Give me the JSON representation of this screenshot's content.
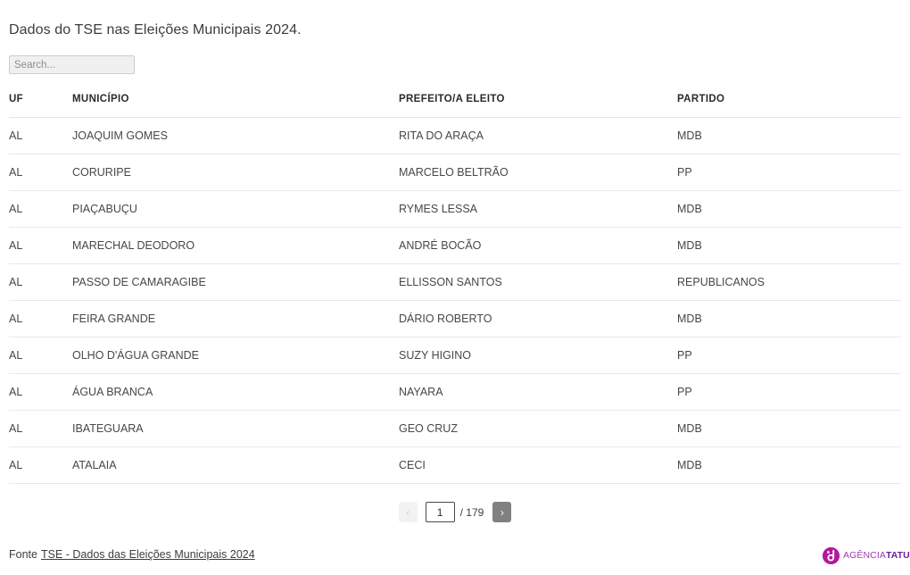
{
  "header": {
    "title": "Dados do TSE nas Eleições Municipais 2024."
  },
  "search": {
    "placeholder": "Search...",
    "value": ""
  },
  "table": {
    "columns": [
      "UF",
      "MUNICÍPIO",
      "PREFEITO/A ELEITO",
      "PARTIDO"
    ],
    "rows": [
      {
        "uf": "AL",
        "municipio": "JOAQUIM GOMES",
        "prefeito": "RITA DO ARAÇA",
        "partido": "MDB"
      },
      {
        "uf": "AL",
        "municipio": "CORURIPE",
        "prefeito": "MARCELO BELTRÃO",
        "partido": "PP"
      },
      {
        "uf": "AL",
        "municipio": "PIAÇABUÇU",
        "prefeito": "RYMES LESSA",
        "partido": "MDB"
      },
      {
        "uf": "AL",
        "municipio": "MARECHAL DEODORO",
        "prefeito": "ANDRÉ BOCÃO",
        "partido": "MDB"
      },
      {
        "uf": "AL",
        "municipio": "PASSO DE CAMARAGIBE",
        "prefeito": "ELLISSON SANTOS",
        "partido": "REPUBLICANOS"
      },
      {
        "uf": "AL",
        "municipio": "FEIRA GRANDE",
        "prefeito": "DÁRIO ROBERTO",
        "partido": "MDB"
      },
      {
        "uf": "AL",
        "municipio": "OLHO D'ÁGUA GRANDE",
        "prefeito": "SUZY HIGINO",
        "partido": "PP"
      },
      {
        "uf": "AL",
        "municipio": "ÁGUA BRANCA",
        "prefeito": "NAYARA",
        "partido": "PP"
      },
      {
        "uf": "AL",
        "municipio": "IBATEGUARA",
        "prefeito": "GEO CRUZ",
        "partido": "MDB"
      },
      {
        "uf": "AL",
        "municipio": "ATALAIA",
        "prefeito": "CECI",
        "partido": "MDB"
      }
    ]
  },
  "pagination": {
    "prev_label": "‹",
    "next_label": "›",
    "current_page": "1",
    "total_label": "/ 179",
    "total_pages": 179,
    "prev_enabled": false,
    "next_enabled": true
  },
  "footer": {
    "prefix": "Fonte",
    "link_label": "TSE - Dados das Eleições Municipais 2024"
  },
  "logo": {
    "text_light": "AGÊNCIA",
    "text_bold": "TATU",
    "mark_color": "#b3189e",
    "text_light_color": "#a13ab5",
    "text_bold_color": "#6c1fa0"
  }
}
